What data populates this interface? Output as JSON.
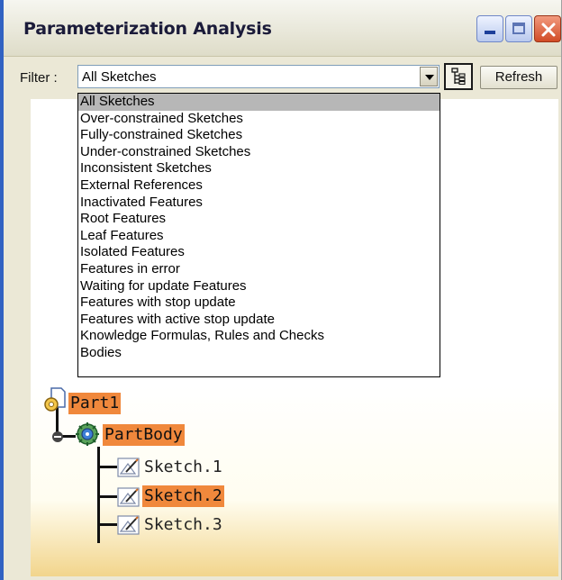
{
  "window": {
    "title": "Parameterization Analysis"
  },
  "toolbar": {
    "filter_label": "Filter :",
    "filter_value": "All Sketches",
    "refresh_label": "Refresh"
  },
  "dropdown": {
    "items": [
      "All Sketches",
      "Over-constrained Sketches",
      "Fully-constrained Sketches",
      "Under-constrained Sketches",
      "Inconsistent Sketches",
      "External References",
      "Inactivated Features",
      "Root Features",
      "Leaf Features",
      "Isolated Features",
      "Features in error",
      "Waiting for update Features",
      "Features with stop update",
      "Features with active stop update",
      "Knowledge Formulas, Rules and Checks",
      "Bodies"
    ],
    "selected_index": 0
  },
  "tree": {
    "root": "Part1",
    "body": "PartBody",
    "sketches": [
      "Sketch.1",
      "Sketch.2",
      "Sketch.3"
    ],
    "highlighted": [
      "Part1",
      "PartBody",
      "Sketch.2"
    ],
    "highlight_color": "#f0883c"
  }
}
